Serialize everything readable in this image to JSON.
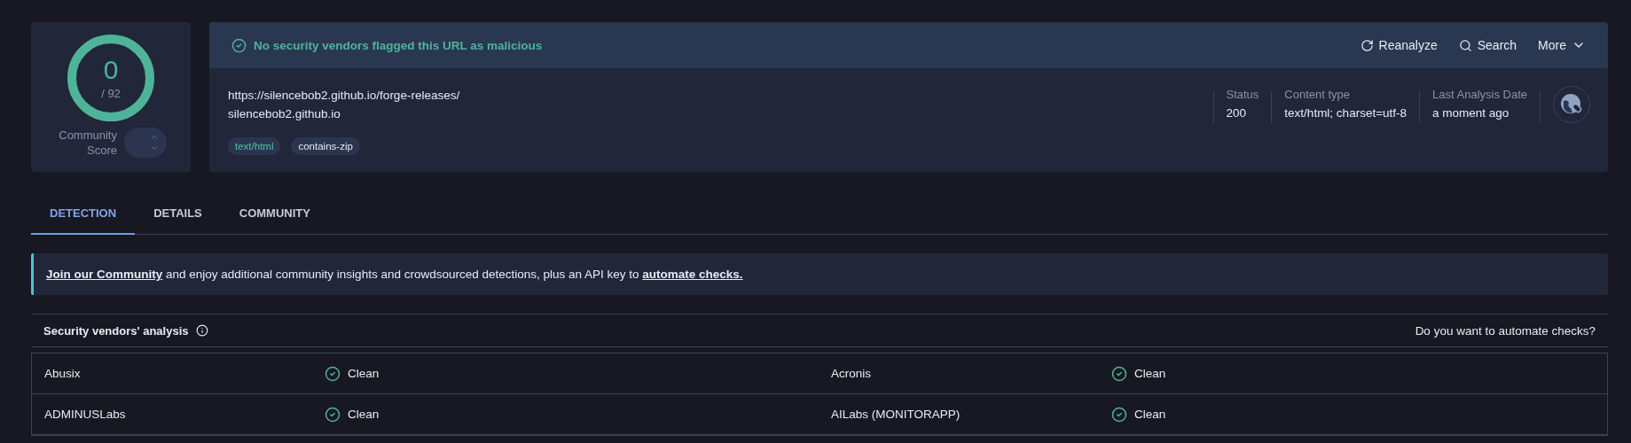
{
  "score": {
    "value": "0",
    "total": "/ 92",
    "label": "Community Score"
  },
  "verdict": {
    "text": "No security vendors flagged this URL as malicious"
  },
  "actions": [
    {
      "kind": "reanalyze",
      "label": "Reanalyze"
    },
    {
      "kind": "search",
      "label": "Search"
    },
    {
      "kind": "more",
      "label": "More"
    }
  ],
  "url": "https://silencebob2.github.io/forge-releases/",
  "domain": "silencebob2.github.io",
  "tags": [
    {
      "label": "text/html",
      "color": "#4fc3a1"
    },
    {
      "label": "contains-zip",
      "color": "#e6ebf5"
    }
  ],
  "meta": [
    {
      "label": "Status",
      "value": "200"
    },
    {
      "label": "Content type",
      "value": "text/html; charset=utf-8"
    },
    {
      "label": "Last Analysis Date",
      "value": "a moment ago"
    }
  ],
  "tabs": [
    {
      "label": "DETECTION",
      "selected": true
    },
    {
      "label": "DETAILS",
      "selected": false
    },
    {
      "label": "COMMUNITY",
      "selected": false
    }
  ],
  "banner": [
    {
      "kind": "link",
      "text": "Join our Community"
    },
    {
      "kind": "text",
      "text": " and enjoy additional community insights and crowdsourced detections, plus an API key to "
    },
    {
      "kind": "link",
      "text": "automate checks."
    }
  ],
  "analysis": {
    "title": "Security vendors' analysis",
    "prompt": "Do you want to automate checks?"
  },
  "vendors": [
    [
      {
        "name": "Abusix",
        "result": "Clean"
      },
      {
        "name": "Acronis",
        "result": "Clean"
      }
    ],
    [
      {
        "name": "ADMINUSLabs",
        "result": "Clean"
      },
      {
        "name": "AILabs (MONITORAPP)",
        "result": "Clean"
      }
    ]
  ]
}
